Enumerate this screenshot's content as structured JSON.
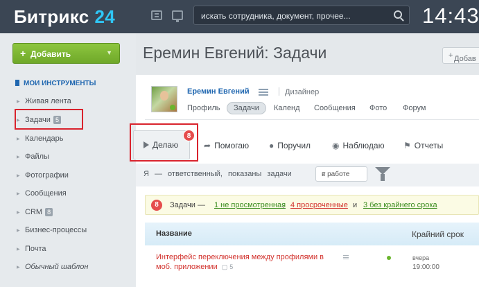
{
  "header": {
    "logo_name": "Битрикс",
    "logo_num": "24",
    "search_placeholder": "искать сотрудника, документ, прочее...",
    "clock": "14:43"
  },
  "sidebar": {
    "add_button": "Добавить",
    "tools_title": "МОИ ИНСТРУМЕНТЫ",
    "items": [
      {
        "label": "Живая лента"
      },
      {
        "label": "Задачи",
        "count": "5"
      },
      {
        "label": "Календарь"
      },
      {
        "label": "Файлы"
      },
      {
        "label": "Фотографии"
      },
      {
        "label": "Сообщения"
      },
      {
        "label": "CRM",
        "count": "8"
      },
      {
        "label": "Бизнес-процессы"
      },
      {
        "label": "Почта"
      },
      {
        "label": "Обычный шаблон"
      }
    ]
  },
  "main": {
    "title": "Еремин Евгений: Задачи",
    "add_right": "Добав",
    "profile": {
      "name": "Еремин Евгений",
      "role": "Дизайнер",
      "tabs": [
        "Профиль",
        "Задачи",
        "Календ",
        "Сообщения",
        "Фото",
        "Форум"
      ],
      "active_tab": "Задачи"
    },
    "task_tabs": {
      "active": "Делаю",
      "active_badge": "8",
      "items": [
        "Помогаю",
        "Поручил",
        "Наблюдаю",
        "Отчеты"
      ]
    },
    "filter": {
      "text": "Я — ответственный, показаны задачи",
      "select": "в работе"
    },
    "alert": {
      "badge": "8",
      "prefix": "Задачи —",
      "link1": "1 не просмотренная",
      "sep": ",",
      "link2": "4 просроченные",
      "and": "и",
      "link3": "3 без крайнего срока"
    },
    "table": {
      "col_name": "Название",
      "col_deadline": "Крайний срок",
      "rows": [
        {
          "title": "Интерфейс переключения между профилями в моб. приложении",
          "comments": "5",
          "deadline_day": "вчера",
          "deadline_time": "19:00:00"
        }
      ]
    }
  },
  "colors": {
    "header_bg": "#3b4654",
    "accent_blue": "#2067b0",
    "add_green": "#7cb83a",
    "alert_red": "#e54d4d",
    "highlight_box": "#d9232d"
  }
}
